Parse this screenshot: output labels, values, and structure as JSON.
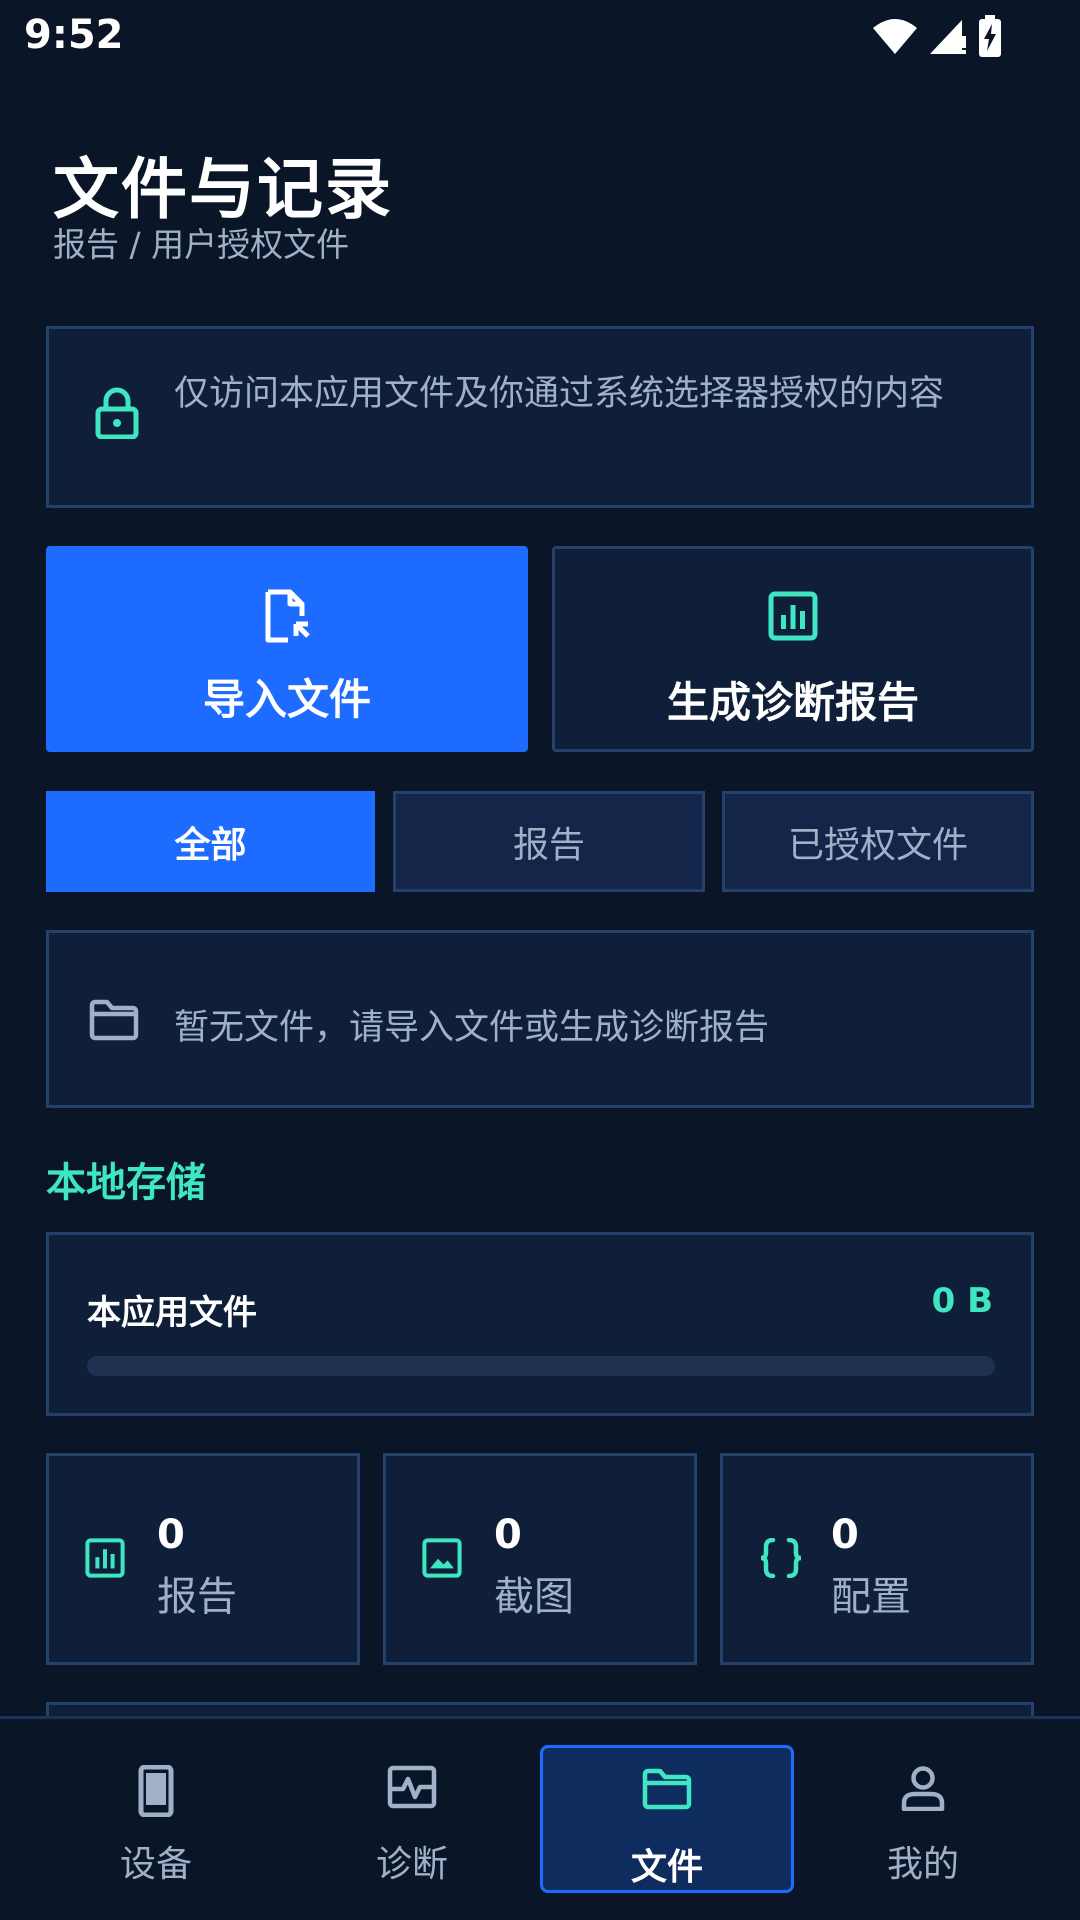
{
  "status_bar": {
    "time": "9:52"
  },
  "header": {
    "title": "文件与记录",
    "breadcrumb": "报告 / 用户授权文件"
  },
  "notice": {
    "icon": "lock-icon",
    "text": "仅访问本应用文件及你通过系统选择器授权的内容"
  },
  "actions": {
    "import_label": "导入文件",
    "report_label": "生成诊断报告"
  },
  "filter_tabs": [
    {
      "label": "全部",
      "selected": true
    },
    {
      "label": "报告",
      "selected": false
    },
    {
      "label": "已授权文件",
      "selected": false
    }
  ],
  "empty_state": {
    "icon": "folder-icon",
    "text": "暂无文件，请导入文件或生成诊断报告"
  },
  "local_storage": {
    "section_title": "本地存储",
    "label": "本应用文件",
    "size": "0 B",
    "usage_fraction": 0
  },
  "stats": [
    {
      "count": "0",
      "label": "报告",
      "icon": "bar-chart-icon"
    },
    {
      "count": "0",
      "label": "截图",
      "icon": "image-icon"
    },
    {
      "count": "0",
      "label": "配置",
      "icon": "braces-icon"
    }
  ],
  "bottom_nav": [
    {
      "label": "设备",
      "icon": "phone-icon",
      "active": false
    },
    {
      "label": "诊断",
      "icon": "pulse-icon",
      "active": false
    },
    {
      "label": "文件",
      "icon": "folder-icon",
      "active": true
    },
    {
      "label": "我的",
      "icon": "person-icon",
      "active": false
    }
  ],
  "colors": {
    "background": "#0a1628",
    "card": "#0f1f3a",
    "border": "#24416a",
    "primary": "#1e6bff",
    "accent": "#3ee6c2",
    "muted_text": "#9fb0c8"
  }
}
